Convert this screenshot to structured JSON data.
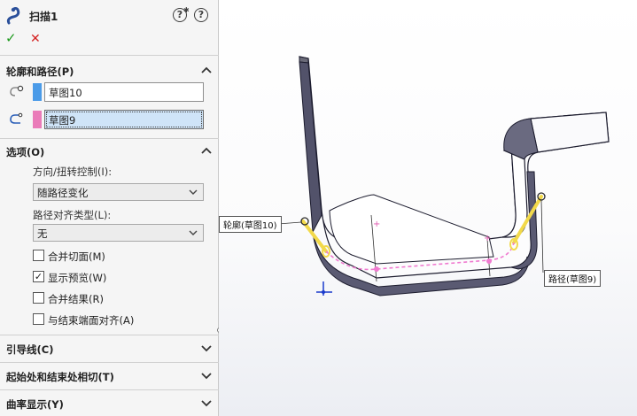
{
  "header": {
    "feature_name": "扫描1",
    "feature_icon": "sweep-icon",
    "help_icons": [
      "whats-new-help-icon",
      "help-icon"
    ],
    "help_glyph": "?"
  },
  "confirm": {
    "ok_icon": "checkmark-icon",
    "ok_glyph": "✓",
    "cancel_icon": "cancel-x-icon",
    "cancel_glyph": "✕"
  },
  "profile_path": {
    "title": "轮廓和路径(P)",
    "profile": {
      "value": "草图10",
      "swatch_color": "#4b9be8",
      "icon": "profile-sketch-icon"
    },
    "path": {
      "value": "草图9",
      "swatch_color": "#ea7bb9",
      "icon": "path-sketch-icon"
    }
  },
  "options": {
    "title": "选项(O)",
    "orientation_label": "方向/扭转控制(I):",
    "orientation_value": "随路径变化",
    "alignment_label": "路径对齐类型(L):",
    "alignment_value": "无",
    "checkboxes": [
      {
        "label": "合并切面(M)",
        "checked": false
      },
      {
        "label": "显示预览(W)",
        "checked": true
      },
      {
        "label": "合并结果(R)",
        "checked": false
      },
      {
        "label": "与结束端面对齐(A)",
        "checked": false
      }
    ]
  },
  "collapsed_sections": [
    {
      "title": "引导线(C)"
    },
    {
      "title": "起始处和结束处相切(T)"
    },
    {
      "title": "曲率显示(Y)"
    }
  ],
  "viewport": {
    "profile_callout": "轮廓(草图10)",
    "path_callout": "路径(草图9)",
    "body_color": "#ffffff",
    "edge_color": "#1c1c2e",
    "path_preview_color": "#f07ad0"
  }
}
